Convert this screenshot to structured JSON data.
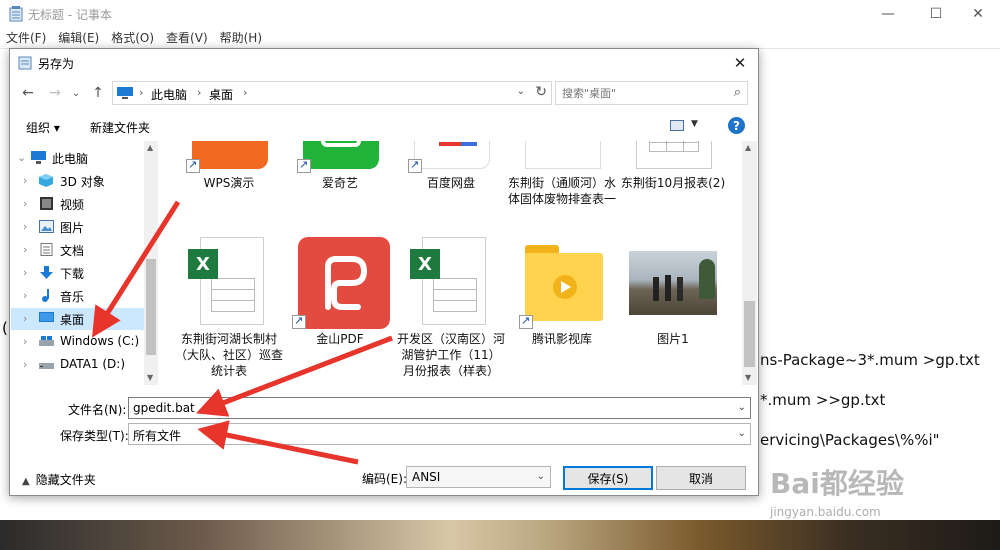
{
  "notepad": {
    "title": "无标题 - 记事本",
    "menu": [
      "文件(F)",
      "编辑(E)",
      "格式(O)",
      "查看(V)",
      "帮助(H)"
    ],
    "window_controls": [
      "—",
      "☐",
      "✕"
    ],
    "lines": [
      "ns-Package~3*.mum >gp.txt",
      "*.mum >>gp.txt",
      "ervicing\\Packages\\%%i\""
    ],
    "left_char": "("
  },
  "watermark": {
    "text": "Bai都经验",
    "sub": "jingyan.baidu.com"
  },
  "dialog": {
    "title": "另存为",
    "close": "✕",
    "address": {
      "crumbs": [
        "此电脑",
        "桌面"
      ],
      "search_placeholder": "搜索\"桌面\""
    },
    "toolbar": {
      "organize": "组织 ▾",
      "new_folder": "新建文件夹",
      "help": "?"
    },
    "tree": [
      {
        "label": "此电脑",
        "icon": "pc-icon"
      },
      {
        "label": "3D 对象",
        "icon": "cube-icon"
      },
      {
        "label": "视频",
        "icon": "video-icon"
      },
      {
        "label": "图片",
        "icon": "picture-icon"
      },
      {
        "label": "文档",
        "icon": "document-icon"
      },
      {
        "label": "下载",
        "icon": "download-icon"
      },
      {
        "label": "音乐",
        "icon": "music-icon"
      },
      {
        "label": "桌面",
        "icon": "desktop-icon"
      },
      {
        "label": "Windows (C:)",
        "icon": "drive-icon"
      },
      {
        "label": "DATA1 (D:)",
        "icon": "drive-icon"
      }
    ],
    "files_row1": [
      {
        "name": "WPS演示"
      },
      {
        "name": "爱奇艺"
      },
      {
        "name": "百度网盘"
      },
      {
        "name": "东荆街（通顺河）水体固体废物排查表一"
      },
      {
        "name": "东荆街10月报表(2)"
      }
    ],
    "files_row2": [
      {
        "name": "东荆街河湖长制村（大队、社区）巡查统计表"
      },
      {
        "name": "金山PDF"
      },
      {
        "name": "开发区（汉南区）河湖管护工作（11）月份报表（样表）"
      },
      {
        "name": "腾讯影视库"
      },
      {
        "name": "图片1"
      }
    ],
    "form": {
      "filename_label": "文件名(N):",
      "filename_value": "gpedit.bat",
      "filetype_label": "保存类型(T):",
      "filetype_value": "所有文件"
    },
    "bottom": {
      "hide_folders": "隐藏文件夹",
      "encoding_label": "编码(E):",
      "encoding_value": "ANSI",
      "save": "保存(S)",
      "cancel": "取消"
    }
  },
  "colors": {
    "accent": "#0078d7",
    "selected": "#cce8ff",
    "arrow": "#e8352b"
  }
}
